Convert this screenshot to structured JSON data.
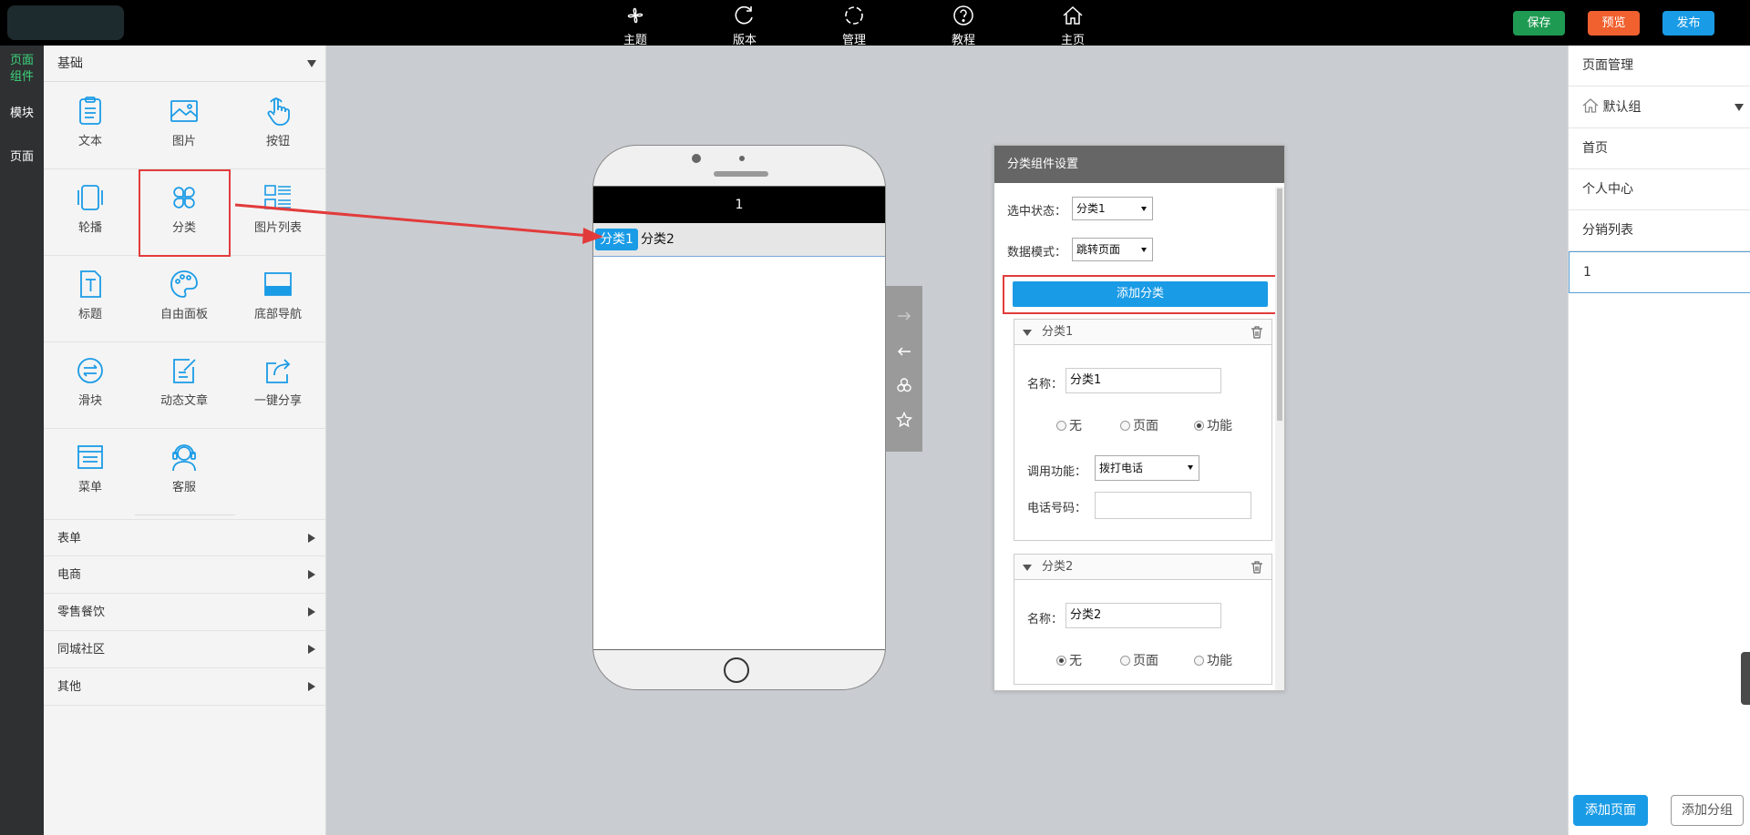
{
  "top_nav": {
    "items": [
      {
        "label": "主题",
        "icon": "pinwheel-icon"
      },
      {
        "label": "版本",
        "icon": "refresh-icon"
      },
      {
        "label": "管理",
        "icon": "dotted-circle-icon"
      },
      {
        "label": "教程",
        "icon": "question-icon"
      },
      {
        "label": "主页",
        "icon": "home-icon"
      }
    ],
    "save_label": "保存",
    "preview_label": "预览",
    "publish_label": "发布"
  },
  "colors": {
    "save": "#1f9a52",
    "preview": "#f0612f",
    "publish": "#1a9be6",
    "accent_blue": "#1a9be6",
    "highlight_red": "#e23b3b",
    "strip_active": "#3cd67a"
  },
  "side_strip": {
    "items": [
      {
        "label": "页面组件"
      },
      {
        "label": "模块"
      },
      {
        "label": "页面"
      }
    ]
  },
  "components": {
    "section_title": "基础",
    "items": [
      {
        "label": "文本",
        "icon": "text-clipboard-icon"
      },
      {
        "label": "图片",
        "icon": "image-icon"
      },
      {
        "label": "按钮",
        "icon": "pointer-hand-icon"
      },
      {
        "label": "轮播",
        "icon": "carousel-icon"
      },
      {
        "label": "分类",
        "icon": "category-grid-icon"
      },
      {
        "label": "图片列表",
        "icon": "image-list-icon"
      },
      {
        "label": "标题",
        "icon": "title-t-icon"
      },
      {
        "label": "自由面板",
        "icon": "palette-icon"
      },
      {
        "label": "底部导航",
        "icon": "bottom-nav-icon"
      },
      {
        "label": "滑块",
        "icon": "slider-icon"
      },
      {
        "label": "动态文章",
        "icon": "article-edit-icon"
      },
      {
        "label": "一键分享",
        "icon": "share-icon"
      },
      {
        "label": "菜单",
        "icon": "menu-icon"
      },
      {
        "label": "客服",
        "icon": "customer-service-icon"
      }
    ],
    "categories": [
      {
        "label": "表单"
      },
      {
        "label": "电商"
      },
      {
        "label": "零售餐饮"
      },
      {
        "label": "同城社区"
      },
      {
        "label": "其他"
      }
    ]
  },
  "phone": {
    "title": "1",
    "tabs": [
      {
        "label": "分类1"
      },
      {
        "label": "分类2"
      }
    ]
  },
  "settings": {
    "title": "分类组件设置",
    "selected_state_label": "选中状态：",
    "selected_state_value": "分类1",
    "data_mode_label": "数据模式：",
    "data_mode_value": "跳转页面",
    "add_category_label": "添加分类",
    "cards": [
      {
        "title": "分类1",
        "name_label": "名称：",
        "name_value": "分类1",
        "options": [
          "无",
          "页面",
          "功能"
        ],
        "selected_option": "功能",
        "function_label": "调用功能：",
        "function_value": "拨打电话",
        "phone_label": "电话号码：",
        "phone_value": ""
      },
      {
        "title": "分类2",
        "name_label": "名称：",
        "name_value": "分类2",
        "options": [
          "无",
          "页面",
          "功能"
        ],
        "selected_option": "无"
      }
    ]
  },
  "page_manager": {
    "title": "页面管理",
    "group_label": "默认组",
    "pages": [
      {
        "label": "首页"
      },
      {
        "label": "个人中心"
      },
      {
        "label": "分销列表"
      }
    ],
    "new_page_value": "1",
    "add_page_label": "添加页面",
    "add_group_label": "添加分组"
  }
}
